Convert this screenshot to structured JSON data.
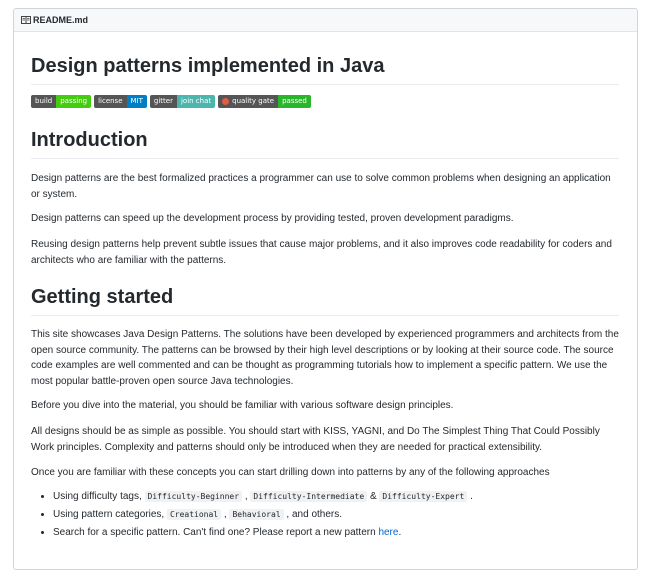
{
  "file_header": {
    "name": "README.md",
    "icon": "book-icon"
  },
  "title": "Design patterns implemented in Java",
  "badges": [
    {
      "label": "build",
      "value": "passing",
      "color": "#4c1"
    },
    {
      "label": "license",
      "value": "MIT",
      "color": "#007ec6"
    },
    {
      "label": "gitter",
      "value": "join chat",
      "color": "#4db6ac"
    },
    {
      "label": "quality gate",
      "value": "passed",
      "color": "#2bb52b",
      "icon": "sonar-icon"
    }
  ],
  "intro": {
    "heading": "Introduction",
    "p1": "Design patterns are the best formalized practices a programmer can use to solve common problems when designing an application or system.",
    "p2": "Design patterns can speed up the development process by providing tested, proven development paradigms.",
    "p3": "Reusing design patterns help prevent subtle issues that cause major problems, and it also improves code readability for coders and architects who are familiar with the patterns."
  },
  "getting_started": {
    "heading": "Getting started",
    "p1": "This site showcases Java Design Patterns. The solutions have been developed by experienced programmers and architects from the open source community. The patterns can be browsed by their high level descriptions or by looking at their source code. The source code examples are well commented and can be thought as programming tutorials how to implement a specific pattern. We use the most popular battle-proven open source Java technologies.",
    "p2": "Before you dive into the material, you should be familiar with various software design principles.",
    "p3": "All designs should be as simple as possible. You should start with KISS, YAGNI, and Do The Simplest Thing That Could Possibly Work principles. Complexity and patterns should only be introduced when they are needed for practical extensibility.",
    "p4": "Once you are familiar with these concepts you can start drilling down into patterns by any of the following approaches",
    "li1": {
      "prefix": "Using difficulty tags, ",
      "c1": "Difficulty-Beginner",
      "sep1": " , ",
      "c2": "Difficulty-Intermediate",
      "sep2": " & ",
      "c3": "Difficulty-Expert",
      "suffix": " ."
    },
    "li2": {
      "prefix": "Using pattern categories, ",
      "c1": "Creational",
      "sep1": " , ",
      "c2": "Behavioral",
      "suffix": " , and others."
    },
    "li3": {
      "prefix": "Search for a specific pattern. Can't find one? Please report a new pattern ",
      "link": "here",
      "suffix": "."
    }
  }
}
